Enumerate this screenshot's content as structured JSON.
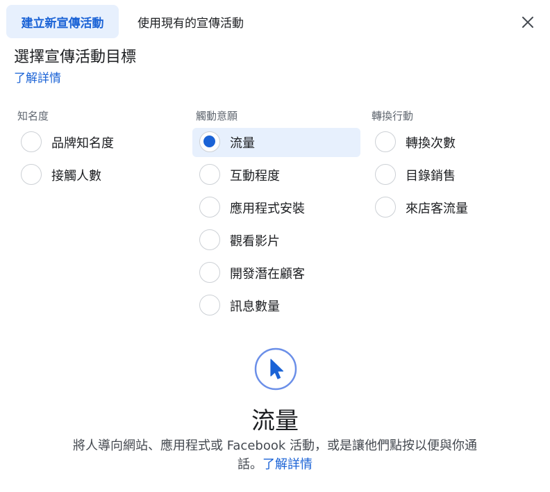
{
  "tabs": [
    {
      "label": "建立新宣傳活動"
    },
    {
      "label": "使用現有的宣傳活動"
    }
  ],
  "header": {
    "title": "選擇宣傳活動目標",
    "learn_more": "了解詳情"
  },
  "columns": [
    {
      "heading": "知名度",
      "options": [
        {
          "label": "品牌知名度"
        },
        {
          "label": "接觸人數"
        }
      ]
    },
    {
      "heading": "觸動意願",
      "options": [
        {
          "label": "流量"
        },
        {
          "label": "互動程度"
        },
        {
          "label": "應用程式安裝"
        },
        {
          "label": "觀看影片"
        },
        {
          "label": "開發潛在顧客"
        },
        {
          "label": "訊息數量"
        }
      ]
    },
    {
      "heading": "轉換行動",
      "options": [
        {
          "label": "轉換次數"
        },
        {
          "label": "目錄銷售"
        },
        {
          "label": "來店客流量"
        }
      ]
    }
  ],
  "selected": {
    "column": 1,
    "option": 0
  },
  "detail": {
    "icon": "cursor-arrow-icon",
    "title": "流量",
    "description": "將人導向網站、應用程式或 Facebook 活動，或是讓他們點按以便與你通話。",
    "learn_more": "了解詳情"
  },
  "colors": {
    "accent": "#1b63d6",
    "selected_bg": "#e7f0fd",
    "icon_stroke": "#6b8fe8"
  }
}
